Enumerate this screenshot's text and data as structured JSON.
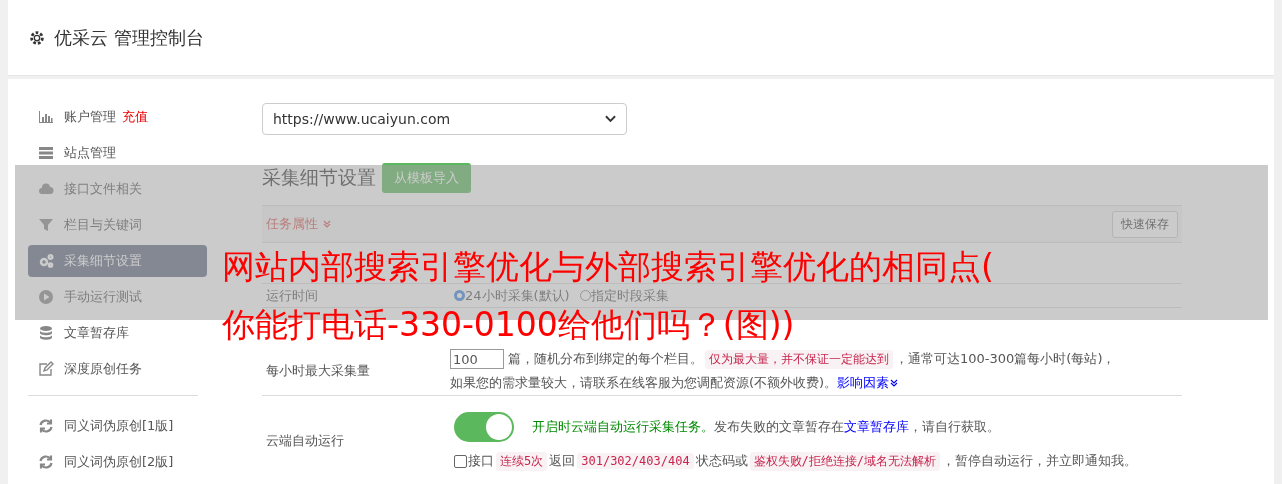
{
  "header": {
    "title": "优采云 管理控制台"
  },
  "sidebar": {
    "items": [
      {
        "label": "账户管理",
        "badge": "充值",
        "selected": false
      },
      {
        "label": "站点管理",
        "selected": false
      },
      {
        "label": "接口文件相关",
        "selected": false
      },
      {
        "label": "栏目与关键词",
        "selected": false
      },
      {
        "label": "采集细节设置",
        "selected": true
      },
      {
        "label": "手动运行测试",
        "selected": false
      },
      {
        "label": "文章暂存库",
        "selected": false
      },
      {
        "label": "深度原创任务",
        "selected": false
      },
      {
        "label": "同义词伪原创[1版]",
        "selected": false,
        "divider_before": true
      },
      {
        "label": "同义词伪原创[2版]",
        "selected": false
      }
    ]
  },
  "site_select": {
    "value": "https://www.ucaiyun.com"
  },
  "section": {
    "title": "采集细节设置",
    "import_button": "从模板导入"
  },
  "panel": {
    "heading": "任务属性",
    "save_button": "快速保存"
  },
  "run_time": {
    "label": "运行时间",
    "options": [
      {
        "label": "24小时采集(默认)",
        "selected": true
      },
      {
        "label": "指定时段采集",
        "selected": false
      }
    ]
  },
  "max_per_hour": {
    "label": "每小时最大采集量",
    "value": "100",
    "text_1": "篇，随机分布到绑定的每个栏目。",
    "note": "仅为最大量，并不保证一定能达到",
    "text_2": "，通常可达100-300篇每小时(每站)，",
    "text_3": "如果您的需求量较大，请联系在线客服为您调配资源(不额外收费)。",
    "link": "影响因素"
  },
  "cloud_run": {
    "label": "云端自动运行",
    "on": true,
    "green_text": "开启时云端自动运行采集任务。",
    "text_1": "发布失败的文章暂存在",
    "link": "文章暂存库",
    "text_2": "，请自行获取。",
    "stop_rule": {
      "checked": false,
      "parts": [
        {
          "kind": "text",
          "text": "接口"
        },
        {
          "kind": "code",
          "text": "连续5次"
        },
        {
          "kind": "text",
          "text": "返回"
        },
        {
          "kind": "code",
          "text": "301/302/403/404"
        },
        {
          "kind": "text",
          "text": "状态码或"
        },
        {
          "kind": "code",
          "text": "鉴权失败/拒绝连接/域名无法解析"
        },
        {
          "kind": "text",
          "text": "，暂停自动运行，并立即通知我。"
        }
      ]
    }
  },
  "overlay": {
    "lines": [
      "网站内部搜索引擎优化与外部搜索引擎优化的相同点(",
      "你能打电话-330-0100给他们吗？(图))"
    ]
  }
}
